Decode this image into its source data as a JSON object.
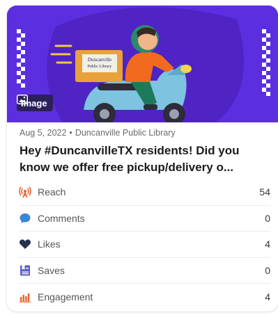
{
  "post": {
    "media_badge": "Image",
    "box_text_line1": "Duncanville",
    "box_text_line2": "Public Library",
    "date": "Aug 5, 2022",
    "separator": "•",
    "source": "Duncanville Public Library",
    "title_line1": "Hey #DuncanvilleTX residents! Did you",
    "title_line2": "know we offer free pickup/delivery o..."
  },
  "metrics": [
    {
      "icon": "reach-icon",
      "label": "Reach",
      "value": "54",
      "color": "#e8612c"
    },
    {
      "icon": "comments-icon",
      "label": "Comments",
      "value": "0",
      "color": "#3a86d8"
    },
    {
      "icon": "likes-icon",
      "label": "Likes",
      "value": "4",
      "color": "#27344d"
    },
    {
      "icon": "saves-icon",
      "label": "Saves",
      "value": "0",
      "color": "#5b5fc7"
    },
    {
      "icon": "engagement-icon",
      "label": "Engagement",
      "value": "4",
      "color": "#e8612c"
    }
  ],
  "colors": {
    "hero_bg": "#5b2ee0",
    "scooter": "#7ec3e0",
    "rider_shirt": "#f26a1f",
    "box": "#e9a23a"
  }
}
